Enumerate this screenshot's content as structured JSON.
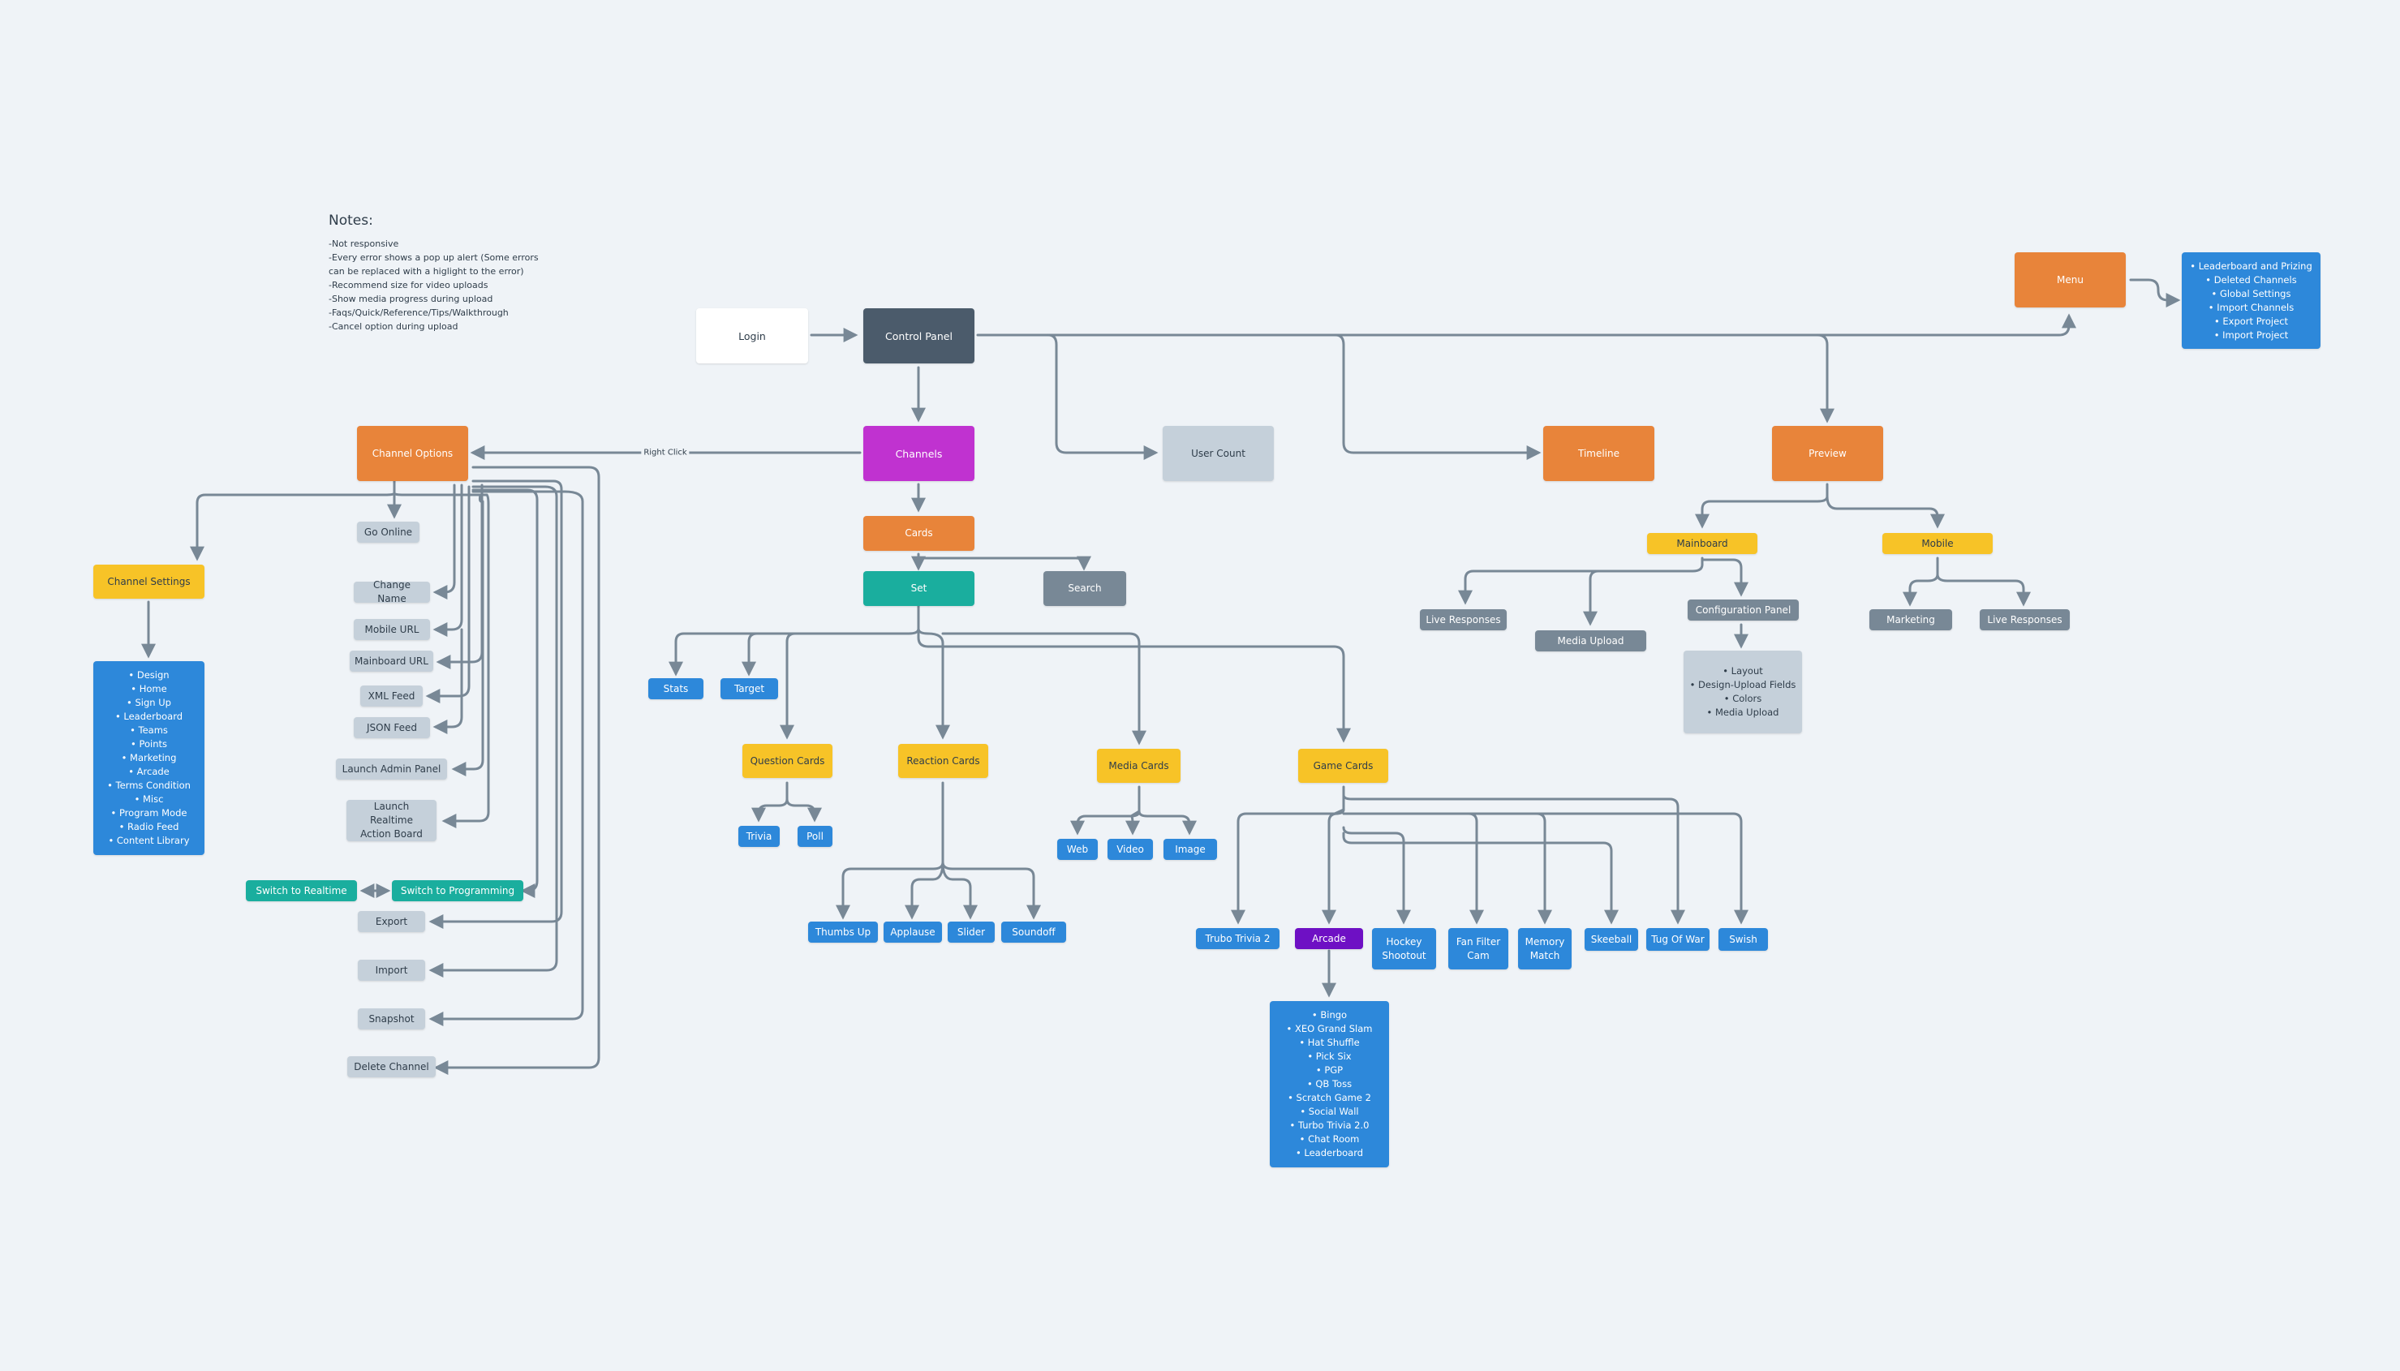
{
  "notes": {
    "title": "Notes:",
    "lines": [
      "-Not responsive",
      "-Every error shows a pop up alert (Some errors",
      "can be replaced with a higlight to the error)",
      "-Recommend size for video uploads",
      "-Show media progress during upload",
      "-Faqs/Quick/Reference/Tips/Walkthrough",
      "-Cancel option during upload"
    ]
  },
  "colors": {
    "background": "#eff3f7",
    "connector": "#788896",
    "white": "#ffffff",
    "slate": "#4b5b6b",
    "magenta": "#c032d0",
    "orange": "#e8843a",
    "teal": "#1aae9e",
    "steel": "#788896",
    "lightgray": "#c5d0da",
    "yellow": "#f7c327",
    "blue": "#2d88da",
    "purple": "#6e10c4"
  },
  "nodes": {
    "login": "Login",
    "control_panel": "Control Panel",
    "channels": "Channels",
    "cards": "Cards",
    "set": "Set",
    "search": "Search",
    "user_count": "User Count",
    "timeline": "Timeline",
    "preview": "Preview",
    "menu": "Menu",
    "menu_list": [
      "• Leaderboard and Prizing",
      "• Deleted Channels",
      "• Global Settings",
      "• Import Channels",
      "• Export Project",
      "• Import Project"
    ],
    "mainboard": "Mainboard",
    "mobile": "Mobile",
    "mainboard_live_responses": "Live Responses",
    "mainboard_media_upload": "Media Upload",
    "configuration_panel": "Configuration Panel",
    "config_list": [
      "• Layout",
      "• Design-Upload Fields",
      "• Colors",
      "• Media Upload"
    ],
    "mobile_marketing": "Marketing",
    "mobile_live_responses": "Live Responses",
    "channel_options": "Channel Options",
    "channel_settings": "Channel Settings",
    "channel_settings_list": [
      "• Design",
      "• Home",
      "• Sign Up",
      "• Leaderboard",
      "• Teams",
      "• Points",
      "• Marketing",
      "• Arcade",
      "• Terms Condition",
      "• Misc",
      "• Program Mode",
      "• Radio Feed",
      "• Content Library"
    ],
    "go_online": "Go Online",
    "change_name": "Change Name",
    "mobile_url": "Mobile URL",
    "mainboard_url": "Mainboard URL",
    "xml_feed": "XML Feed",
    "json_feed": "JSON Feed",
    "launch_admin_panel": "Launch Admin Panel",
    "launch_realtime_1": "Launch Realtime",
    "launch_realtime_2": "Action Board",
    "switch_realtime": "Switch to Realtime",
    "switch_programming": "Switch to Programming",
    "export": "Export",
    "import": "Import",
    "snapshot": "Snapshot",
    "delete_channel": "Delete Channel",
    "stats": "Stats",
    "target": "Target",
    "question_cards": "Question Cards",
    "reaction_cards": "Reaction Cards",
    "media_cards": "Media Cards",
    "game_cards": "Game Cards",
    "trivia": "Trivia",
    "poll": "Poll",
    "thumbs_up": "Thumbs Up",
    "applause": "Applause",
    "slider": "Slider",
    "soundoff": "Soundoff",
    "web": "Web",
    "video": "Video",
    "image": "Image",
    "trubo_trivia_2": "Trubo Trivia 2",
    "arcade": "Arcade",
    "hockey_1": "Hockey",
    "hockey_2": "Shootout",
    "fan_filter_1": "Fan Filter",
    "fan_filter_2": "Cam",
    "memory_1": "Memory",
    "memory_2": "Match",
    "skeeball": "Skeeball",
    "tug_of_war": "Tug Of War",
    "swish": "Swish",
    "arcade_list": [
      "• Bingo",
      "• XEO Grand Slam",
      "• Hat Shuffle",
      "• Pick Six",
      "• PGP",
      "• QB Toss",
      "• Scratch Game 2",
      "• Social Wall",
      "• Turbo Trivia 2.0",
      "• Chat Room",
      "• Leaderboard"
    ]
  },
  "edge_labels": {
    "right_click": "Right Click"
  }
}
